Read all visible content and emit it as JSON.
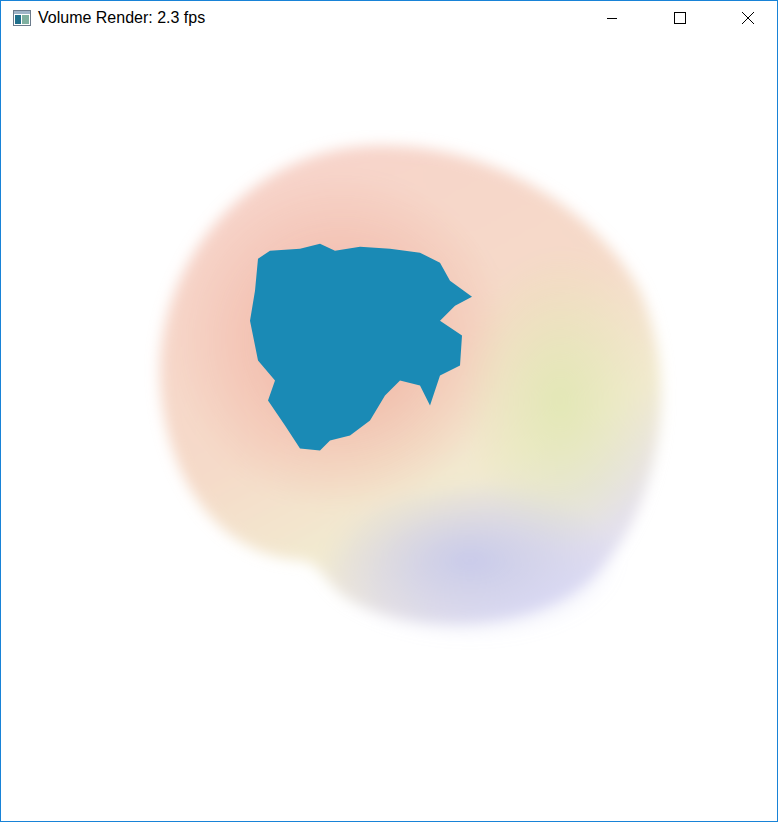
{
  "window": {
    "title": "Volume Render: 2.3 fps"
  }
}
